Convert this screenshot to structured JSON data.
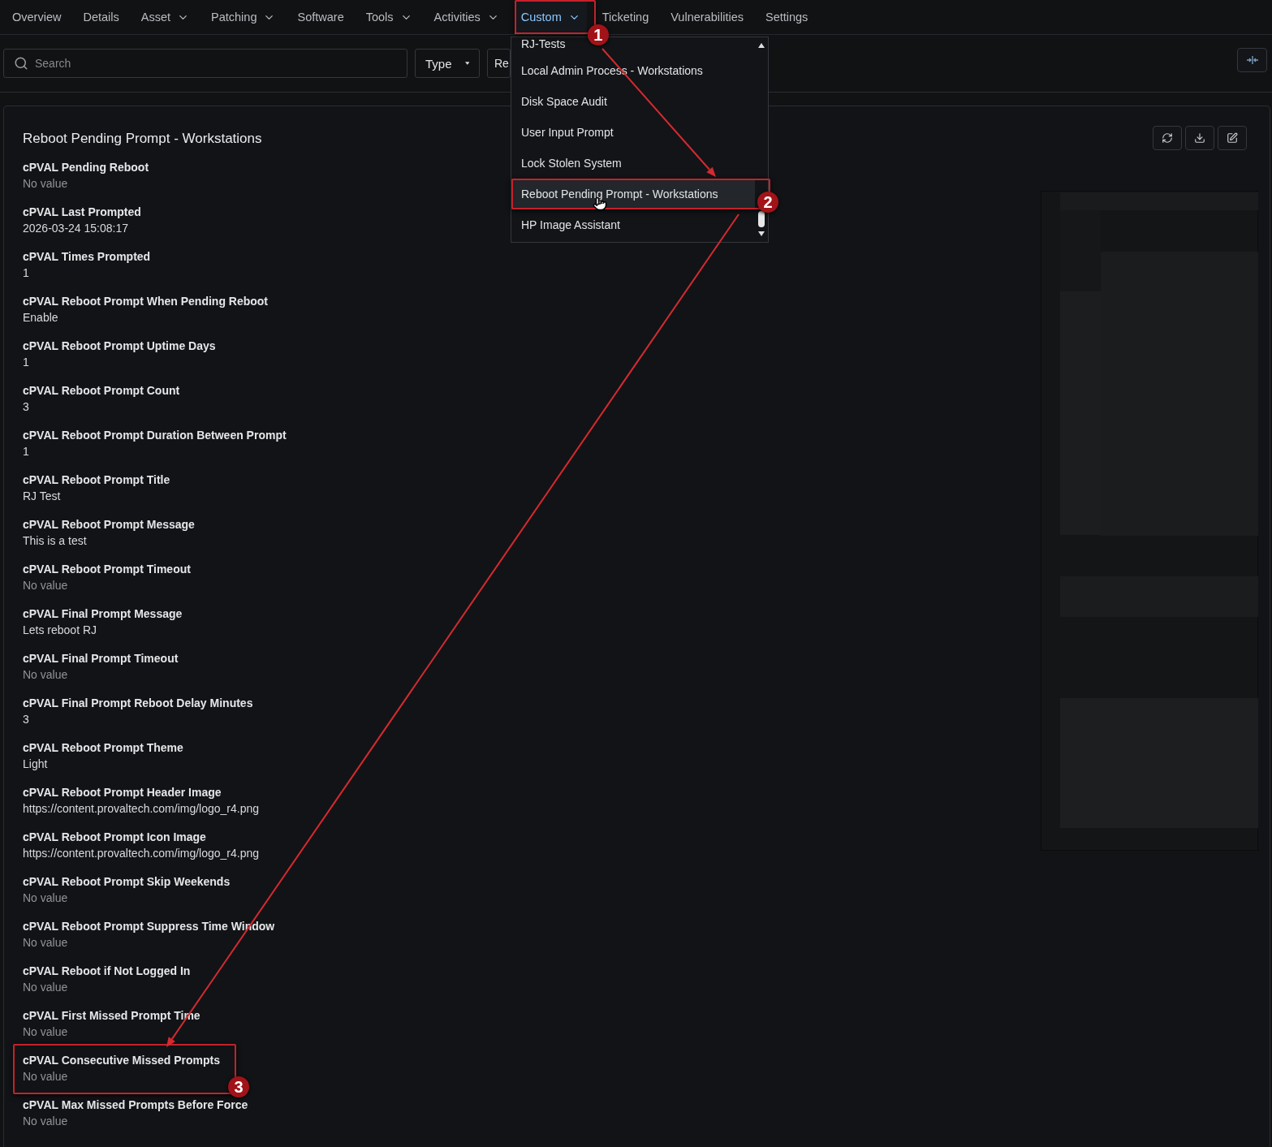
{
  "nav": {
    "tabs": [
      {
        "label": "Overview",
        "selected": false,
        "has_menu": false
      },
      {
        "label": "Details",
        "selected": false,
        "has_menu": false
      },
      {
        "label": "Asset",
        "selected": false,
        "has_menu": true
      },
      {
        "label": "Patching",
        "selected": false,
        "has_menu": true
      },
      {
        "label": "Software",
        "selected": false,
        "has_menu": false
      },
      {
        "label": "Tools",
        "selected": false,
        "has_menu": true
      },
      {
        "label": "Activities",
        "selected": false,
        "has_menu": true
      },
      {
        "label": "Custom",
        "selected": true,
        "has_menu": true,
        "callout": "1"
      },
      {
        "label": "Ticketing",
        "selected": false,
        "has_menu": false
      },
      {
        "label": "Vulnerabilities",
        "selected": false,
        "has_menu": false
      },
      {
        "label": "Settings",
        "selected": false,
        "has_menu": false
      }
    ]
  },
  "custom_menu": {
    "items": [
      {
        "label": "RJ-Tests",
        "selected": false
      },
      {
        "label": "Local Admin Process - Workstations",
        "selected": false
      },
      {
        "label": "Disk Space Audit",
        "selected": false
      },
      {
        "label": "User Input Prompt",
        "selected": false
      },
      {
        "label": "Lock Stolen System",
        "selected": false
      },
      {
        "label": "Reboot Pending Prompt - Workstations",
        "selected": true,
        "callout": "2"
      },
      {
        "label": "HP Image Assistant",
        "selected": false
      }
    ]
  },
  "filters": {
    "search": {
      "placeholder": "Search"
    },
    "type_button": "Type",
    "second_button": "Re"
  },
  "card": {
    "title": "Reboot Pending Prompt - Workstations",
    "fields": [
      {
        "label": "cPVAL Pending Reboot",
        "value": "No value",
        "empty": true
      },
      {
        "label": "cPVAL Last Prompted",
        "value": "2026-03-24 15:08:17",
        "empty": false
      },
      {
        "label": "cPVAL Times Prompted",
        "value": "1",
        "empty": false
      },
      {
        "label": "cPVAL Reboot Prompt When Pending Reboot",
        "value": "Enable",
        "empty": false
      },
      {
        "label": "cPVAL Reboot Prompt Uptime Days",
        "value": "1",
        "empty": false
      },
      {
        "label": "cPVAL Reboot Prompt Count",
        "value": "3",
        "empty": false
      },
      {
        "label": "cPVAL Reboot Prompt Duration Between Prompt",
        "value": "1",
        "empty": false
      },
      {
        "label": "cPVAL Reboot Prompt Title",
        "value": "RJ Test",
        "empty": false
      },
      {
        "label": "cPVAL Reboot Prompt Message",
        "value": "This is a test",
        "empty": false
      },
      {
        "label": "cPVAL Reboot Prompt Timeout",
        "value": "No value",
        "empty": true
      },
      {
        "label": "cPVAL Final Prompt Message",
        "value": "Lets reboot RJ",
        "empty": false
      },
      {
        "label": "cPVAL Final Prompt Timeout",
        "value": "No value",
        "empty": true
      },
      {
        "label": "cPVAL Final Prompt Reboot Delay Minutes",
        "value": "3",
        "empty": false
      },
      {
        "label": "cPVAL Reboot Prompt Theme",
        "value": "Light",
        "empty": false
      },
      {
        "label": "cPVAL Reboot Prompt Header Image",
        "value": "https://content.provaltech.com/img/logo_r4.png",
        "empty": false
      },
      {
        "label": "cPVAL Reboot Prompt Icon Image",
        "value": "https://content.provaltech.com/img/logo_r4.png",
        "empty": false
      },
      {
        "label": "cPVAL Reboot Prompt Skip Weekends",
        "value": "No value",
        "empty": true
      },
      {
        "label": "cPVAL Reboot Prompt Suppress Time Window",
        "value": "No value",
        "empty": true
      },
      {
        "label": "cPVAL Reboot if Not Logged In",
        "value": "No value",
        "empty": true
      },
      {
        "label": "cPVAL First Missed Prompt Time",
        "value": "No value",
        "empty": true
      },
      {
        "label": "cPVAL Consecutive Missed Prompts",
        "value": "No value",
        "empty": true,
        "callout": "3"
      },
      {
        "label": "cPVAL Max Missed Prompts Before Force",
        "value": "No value",
        "empty": true
      }
    ]
  }
}
